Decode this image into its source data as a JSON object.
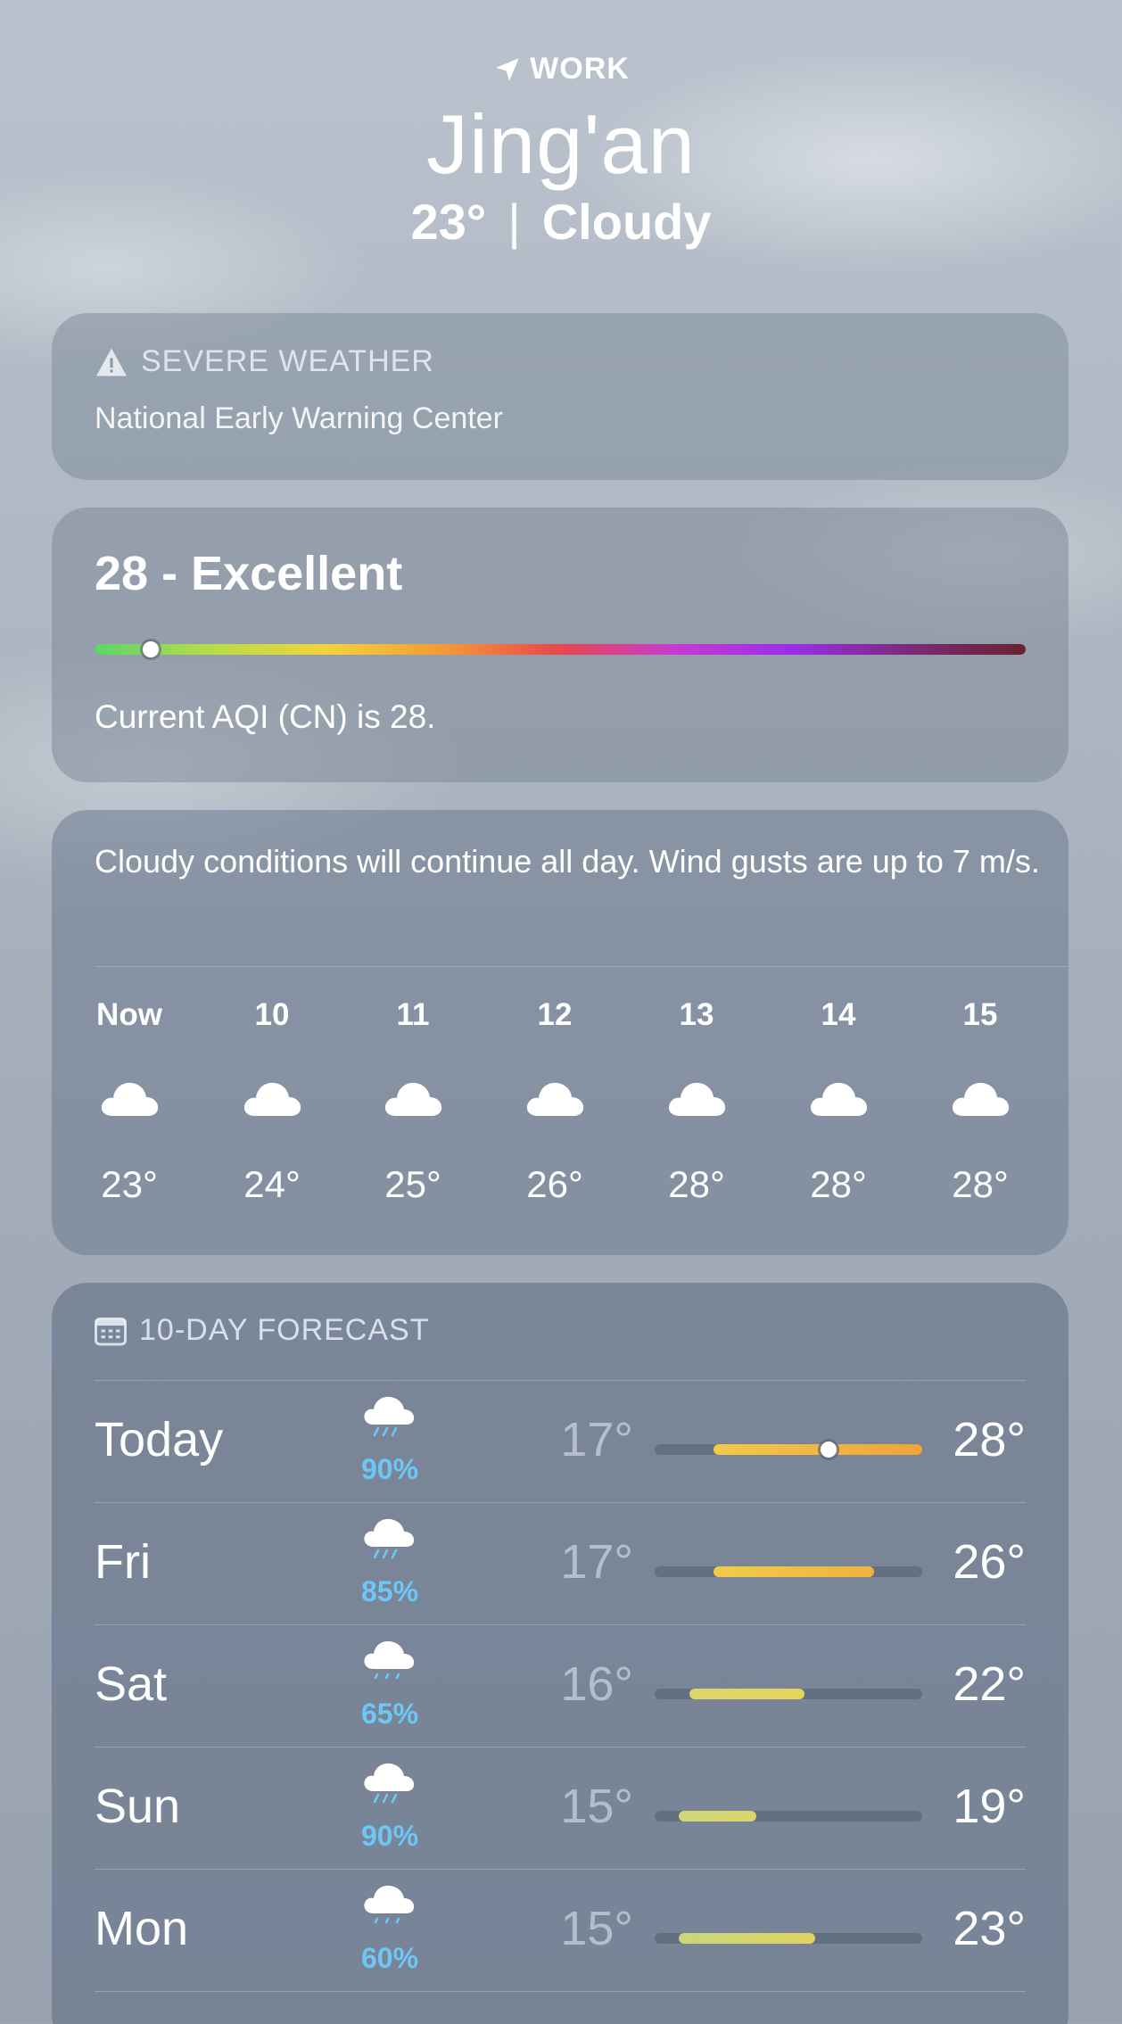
{
  "location": {
    "tag": "WORK",
    "city": "Jing'an",
    "temperature": "23°",
    "separator": "|",
    "condition": "Cloudy"
  },
  "severe": {
    "title": "SEVERE WEATHER",
    "source": "National Early Warning Center"
  },
  "aqi": {
    "headline": "28 - Excellent",
    "description": "Current AQI (CN) is 28.",
    "value_fraction": 0.06
  },
  "hourly": {
    "summary": "Cloudy conditions will continue all day. Wind gusts are up to 7 m/s.",
    "hours": [
      {
        "label": "Now",
        "icon": "cloud-icon",
        "temp": "23°"
      },
      {
        "label": "10",
        "icon": "cloud-icon",
        "temp": "24°"
      },
      {
        "label": "11",
        "icon": "cloud-icon",
        "temp": "25°"
      },
      {
        "label": "12",
        "icon": "cloud-icon",
        "temp": "26°"
      },
      {
        "label": "13",
        "icon": "cloud-icon",
        "temp": "28°"
      },
      {
        "label": "14",
        "icon": "cloud-icon",
        "temp": "28°"
      },
      {
        "label": "15",
        "icon": "cloud-icon",
        "temp": "28°"
      }
    ]
  },
  "ten_day": {
    "title": "10-DAY FORECAST",
    "days": [
      {
        "day": "Today",
        "icon": "cloud-rain-icon",
        "precip": "90%",
        "low": "17°",
        "high": "28°",
        "range_start": 0.22,
        "range_end": 1.0,
        "current_marker": 0.65,
        "colors": [
          "#f2c94c",
          "#f0a33a"
        ]
      },
      {
        "day": "Fri",
        "icon": "cloud-rain-icon",
        "precip": "85%",
        "low": "17°",
        "high": "26°",
        "range_start": 0.22,
        "range_end": 0.82,
        "colors": [
          "#f0cc4a",
          "#efb33c"
        ]
      },
      {
        "day": "Sat",
        "icon": "cloud-drizzle-icon",
        "precip": "65%",
        "low": "16°",
        "high": "22°",
        "range_start": 0.13,
        "range_end": 0.56,
        "colors": [
          "#dcd56c",
          "#e5d45e"
        ]
      },
      {
        "day": "Sun",
        "icon": "cloud-rain-icon",
        "precip": "90%",
        "low": "15°",
        "high": "19°",
        "range_start": 0.09,
        "range_end": 0.38,
        "colors": [
          "#c9d77c",
          "#dcd46a"
        ]
      },
      {
        "day": "Mon",
        "icon": "cloud-drizzle-icon",
        "precip": "60%",
        "low": "15°",
        "high": "23°",
        "range_start": 0.09,
        "range_end": 0.6,
        "colors": [
          "#c9d77c",
          "#e2d35f"
        ]
      }
    ]
  },
  "colors": {
    "precip": "#6cc7f7",
    "aqi_gradient": [
      "#5ed36a",
      "#b7dc4a",
      "#f2d33c",
      "#f19a36",
      "#e8474f",
      "#c43bd2",
      "#9b2ee8",
      "#7a2a7a",
      "#6a2330"
    ]
  }
}
